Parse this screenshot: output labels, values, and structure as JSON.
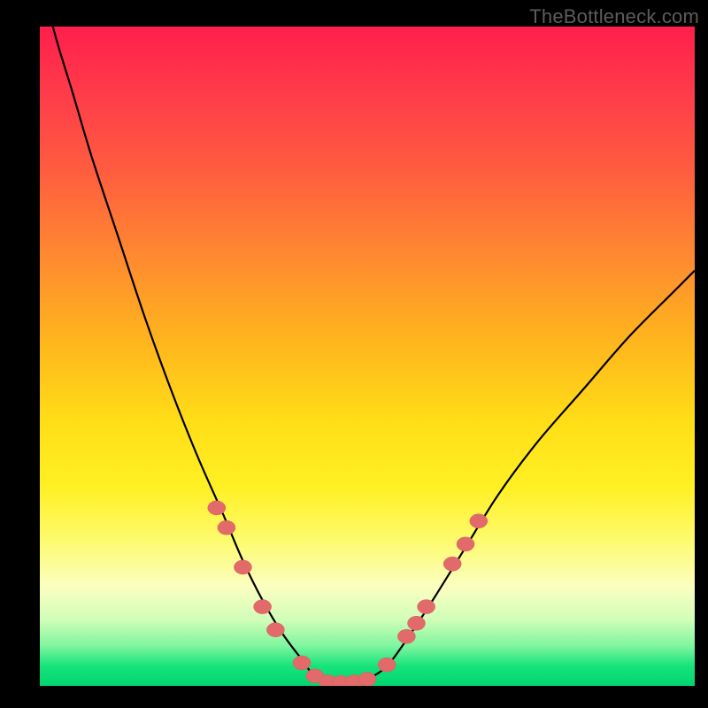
{
  "watermark": "TheBottleneck.com",
  "chart_data": {
    "type": "line",
    "title": "",
    "xlabel": "",
    "ylabel": "",
    "xlim": [
      0,
      100
    ],
    "ylim": [
      0,
      100
    ],
    "grid": false,
    "legend": false,
    "note": "Axis values and tick labels are not shown in the image; x/y are nominal percent coordinates. y≈0 is optimal (green), y≈100 is worst (red). Curve is a V-shaped bottleneck profile with flat minimum near x≈42–50.",
    "series": [
      {
        "name": "bottleneck-curve",
        "x": [
          0,
          2,
          5,
          8,
          12,
          16,
          20,
          24,
          28,
          31,
          34,
          37,
          40,
          42,
          45,
          48,
          50,
          53,
          56,
          60,
          65,
          70,
          76,
          83,
          90,
          97,
          100
        ],
        "y": [
          110,
          100,
          90,
          80,
          68,
          56,
          45,
          35,
          26,
          19,
          13,
          8,
          4,
          1.5,
          0.5,
          0.5,
          1.0,
          3,
          7,
          13,
          21,
          29,
          37,
          45,
          53,
          60,
          63
        ]
      }
    ],
    "markers": {
      "name": "highlight-dots",
      "color": "#e26a6a",
      "points": [
        {
          "x": 27,
          "y": 27
        },
        {
          "x": 28.5,
          "y": 24
        },
        {
          "x": 31,
          "y": 18
        },
        {
          "x": 34,
          "y": 12
        },
        {
          "x": 36,
          "y": 8.5
        },
        {
          "x": 40,
          "y": 3.5
        },
        {
          "x": 42,
          "y": 1.5
        },
        {
          "x": 44,
          "y": 0.6
        },
        {
          "x": 46,
          "y": 0.5
        },
        {
          "x": 48,
          "y": 0.6
        },
        {
          "x": 50,
          "y": 1.0
        },
        {
          "x": 53,
          "y": 3.2
        },
        {
          "x": 56,
          "y": 7.5
        },
        {
          "x": 57.5,
          "y": 9.5
        },
        {
          "x": 59,
          "y": 12
        },
        {
          "x": 63,
          "y": 18.5
        },
        {
          "x": 65,
          "y": 21.5
        },
        {
          "x": 67,
          "y": 25
        }
      ]
    },
    "background_gradient": {
      "top_color": "#ff1f4c",
      "bottom_color": "#00d66f",
      "meaning": "red=high bottleneck, green=no bottleneck"
    }
  }
}
